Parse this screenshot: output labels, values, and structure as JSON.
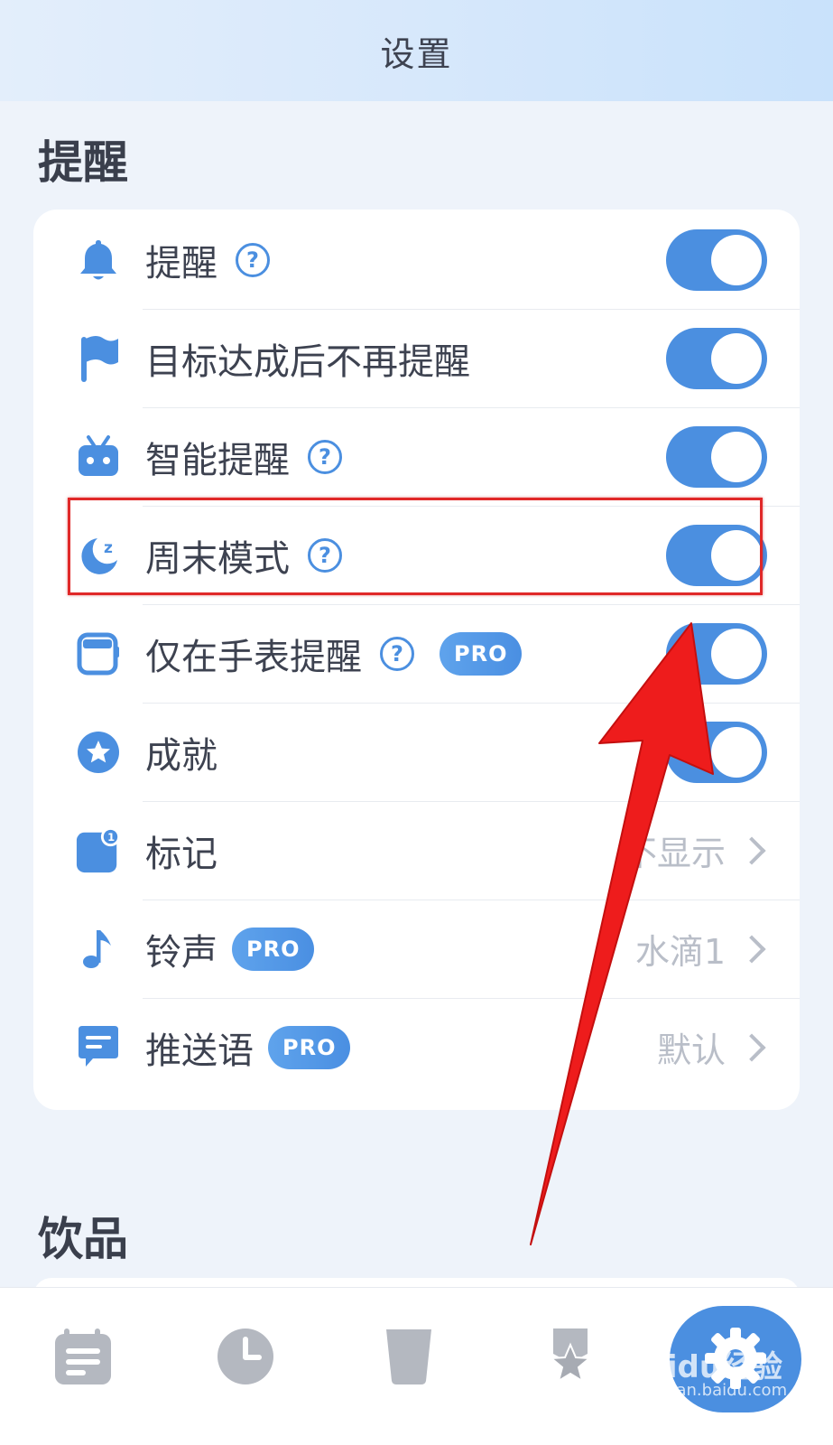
{
  "header": {
    "title": "设置"
  },
  "sections": {
    "reminder_title": "提醒",
    "drinks_title": "饮品"
  },
  "rows": [
    {
      "label": "提醒",
      "icon": "bell-icon",
      "help": true,
      "toggle": true
    },
    {
      "label": "目标达成后不再提醒",
      "icon": "flag-icon",
      "toggle": true
    },
    {
      "label": "智能提醒",
      "icon": "robot-icon",
      "help": true,
      "toggle": true
    },
    {
      "label": "周末模式",
      "icon": "moon-sleep-icon",
      "help": true,
      "toggle": true
    },
    {
      "label": "仅在手表提醒",
      "icon": "watch-icon",
      "help": true,
      "pro": "PRO",
      "toggle": true
    },
    {
      "label": "成就",
      "icon": "star-badge-icon",
      "toggle": true
    },
    {
      "label": "标记",
      "icon": "badge-mark-icon",
      "value": "不显示",
      "badge_count": "1"
    },
    {
      "label": "铃声",
      "icon": "music-note-icon",
      "pro": "PRO",
      "value": "水滴1"
    },
    {
      "label": "推送语",
      "icon": "chat-icon",
      "pro": "PRO",
      "value": "默认"
    }
  ],
  "help_glyph": "?",
  "tabs": [
    {
      "name": "tab-records",
      "icon": "list-icon"
    },
    {
      "name": "tab-history",
      "icon": "clock-icon"
    },
    {
      "name": "tab-drink",
      "icon": "cup-icon"
    },
    {
      "name": "tab-achievements",
      "icon": "star-icon"
    },
    {
      "name": "tab-settings",
      "icon": "gear-icon",
      "active": true
    }
  ],
  "watermark": {
    "brand": "Baidu经验",
    "url": "jingyan.baidu.com"
  },
  "colors": {
    "accent": "#4b8fe0",
    "highlight": "#e02828",
    "arrow": "#ee1c1c"
  }
}
